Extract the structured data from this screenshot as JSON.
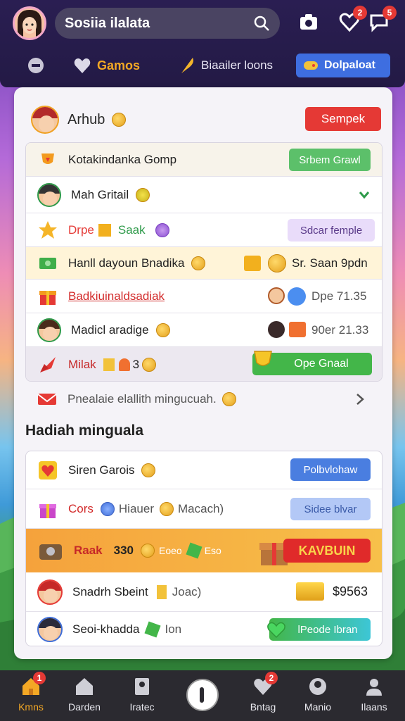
{
  "header": {
    "search_text": "Sosiia ilalata",
    "notif_badge_1": "2",
    "notif_badge_2": "5"
  },
  "tabs": {
    "tab1_label": "Gamos",
    "tab2_label": "Biaailer loons",
    "tab3_label": "Dolpaloat"
  },
  "user": {
    "name": "Arhub",
    "button_label": "Sempek"
  },
  "list": {
    "rows": [
      {
        "label": "Kotakindanka Gomp",
        "pill": "Srbem Grawl"
      },
      {
        "label": "Mah Gritail"
      },
      {
        "label1": "Drpe",
        "label2": "Saak",
        "pill": "Sdcar femple"
      },
      {
        "label": "Hanll dayoun Bnadika",
        "right": "Sr. Saan 9pdn"
      },
      {
        "label": "Badkiuinaldsadiak",
        "right": "Dpe 71.35"
      },
      {
        "label": "Madicl aradige",
        "right": "90er 21.33"
      },
      {
        "label": "Milak",
        "count": "3",
        "pill": "Ope Gnaal"
      },
      {
        "label": "Pnealaie elallith mingucuah."
      }
    ]
  },
  "section": {
    "title": "Hadiah minguala"
  },
  "list2": {
    "rows": [
      {
        "label": "Siren Garois",
        "pill": "Polbvlohaw"
      },
      {
        "label": "Cors",
        "label2": "Hiauer",
        "label3": "Macach)",
        "pill": "Sidee blvar"
      },
      {
        "label": "Raak",
        "value": "330",
        "label2": "Eoeo",
        "label3": "Eso",
        "pill": "KAVBUIN"
      },
      {
        "label": "Snadrh Sbeint",
        "label2": "Joac)",
        "value": "$9563"
      },
      {
        "label": "Seoi-khadda",
        "label2": "Ion",
        "pill": "lPeode Ibran"
      }
    ]
  },
  "bottom_nav": {
    "items": [
      {
        "label": "Kmns",
        "badge": "1"
      },
      {
        "label": "Darden"
      },
      {
        "label": "Iratec"
      },
      {
        "label": "Bntag",
        "badge": "2"
      },
      {
        "label": "Manio"
      },
      {
        "label": "Ilaans"
      }
    ]
  },
  "colors": {
    "accent_red": "#e53935",
    "accent_green": "#43b649",
    "accent_blue": "#3e6ee0",
    "header_bg": "#2a1e52"
  }
}
